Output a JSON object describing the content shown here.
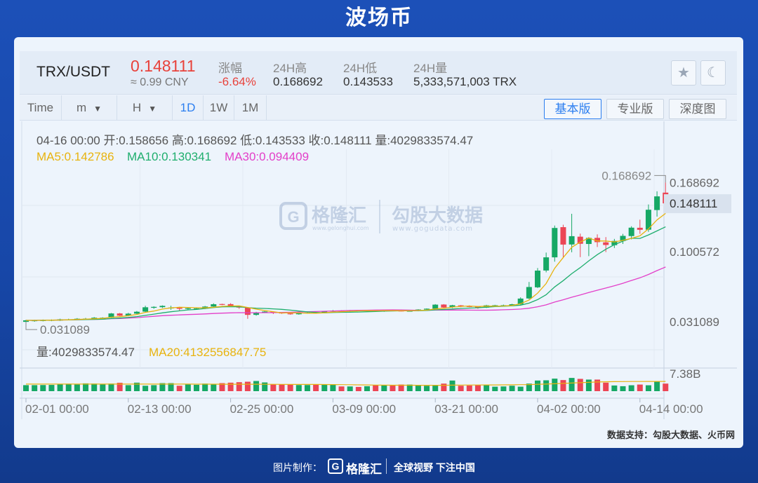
{
  "page": {
    "title": "波场币",
    "source_note": "数据支持：勾股大数据、火币网",
    "footer": {
      "credit": "图片制作：",
      "logo_letter": "G",
      "logo_name": "格隆汇",
      "slogan": "全球视野 下注中国"
    },
    "watermark": {
      "brand1": "格隆汇",
      "brand1_sub": "www.gelonghui.com",
      "brand2": "勾股大数据",
      "brand2_sub": "www.gogudata.com"
    }
  },
  "header": {
    "pair": "TRX/USDT",
    "price": "0.148111",
    "cny": "≈ 0.99 CNY",
    "stats": [
      {
        "label": "涨幅",
        "value": "-6.64%",
        "color": "red"
      },
      {
        "label": "24H高",
        "value": "0.168692",
        "color": "normal"
      },
      {
        "label": "24H低",
        "value": "0.143533",
        "color": "normal"
      },
      {
        "label": "24H量",
        "value": "5,333,571,003 TRX",
        "color": "normal"
      }
    ],
    "icons": [
      "star-icon",
      "moon-icon"
    ]
  },
  "toolbar": {
    "time_label": "Time",
    "minute_select": "m",
    "hour_select": "H",
    "intervals": [
      "1D",
      "1W",
      "1M"
    ],
    "active_interval": "1D",
    "views": [
      "基本版",
      "专业版",
      "深度图"
    ],
    "active_view": "基本版"
  },
  "chart_data": {
    "type": "candlestick",
    "info_line": {
      "date": "04-16 00:00",
      "open_label": "开:",
      "open": "0.158656",
      "high_label": "高:",
      "high": "0.168692",
      "low_label": "低:",
      "low": "0.143533",
      "close_label": "收:",
      "close": "0.148111",
      "vol_label": "量:",
      "vol": "4029833574.47"
    },
    "ma_legend": [
      {
        "label": "MA5:0.142786",
        "color": "#e8b30e"
      },
      {
        "label": "MA10:0.130341",
        "color": "#1fae6e"
      },
      {
        "label": "MA30:0.094409",
        "color": "#e33fc9"
      }
    ],
    "price_axis": {
      "ticks": [
        "0.168692",
        "0.100572",
        "0.031089"
      ],
      "current": "0.148111",
      "range": [
        0.0215,
        0.189
      ]
    },
    "max_label": "0.168692",
    "min_label": "0.031089",
    "volume_legend": [
      {
        "label": "量:4029833574.47",
        "color": "#555555"
      },
      {
        "label": "MA20:4132556847.75",
        "color": "#e8b30e"
      }
    ],
    "volume_axis": {
      "tick": "7.38B",
      "tick_value": 7.38,
      "range": [
        0,
        8.6
      ],
      "unit": "B"
    },
    "x_ticks": [
      {
        "label": "02-01 00:00",
        "index": 0
      },
      {
        "label": "02-13 00:00",
        "index": 12
      },
      {
        "label": "02-25 00:00",
        "index": 24
      },
      {
        "label": "03-09 00:00",
        "index": 36
      },
      {
        "label": "03-21 00:00",
        "index": 48
      },
      {
        "label": "04-02 00:00",
        "index": 60
      },
      {
        "label": "04-14 00:00",
        "index": 72
      }
    ],
    "candles": [
      [
        0.0311,
        0.0326,
        0.0331,
        0.0305
      ],
      [
        0.0318,
        0.0326,
        0.0331,
        0.0312
      ],
      [
        0.032,
        0.0328,
        0.0334,
        0.0316
      ],
      [
        0.0323,
        0.033,
        0.0335,
        0.0318
      ],
      [
        0.0324,
        0.0336,
        0.0342,
        0.032
      ],
      [
        0.0331,
        0.0336,
        0.0342,
        0.0328
      ],
      [
        0.0334,
        0.0342,
        0.0348,
        0.033
      ],
      [
        0.0338,
        0.0343,
        0.035,
        0.0334
      ],
      [
        0.034,
        0.0352,
        0.0358,
        0.0336
      ],
      [
        0.0351,
        0.0352,
        0.0356,
        0.0345
      ],
      [
        0.0352,
        0.0394,
        0.0398,
        0.035
      ],
      [
        0.0394,
        0.0372,
        0.0399,
        0.0368
      ],
      [
        0.0371,
        0.0392,
        0.04,
        0.0366
      ],
      [
        0.0392,
        0.0411,
        0.0418,
        0.0388
      ],
      [
        0.0412,
        0.0455,
        0.047,
        0.0405
      ],
      [
        0.045,
        0.0459,
        0.0465,
        0.044
      ],
      [
        0.0456,
        0.0469,
        0.0474,
        0.0448
      ],
      [
        0.0452,
        0.0452,
        0.047,
        0.043
      ],
      [
        0.045,
        0.044,
        0.046,
        0.042
      ],
      [
        0.0441,
        0.0446,
        0.0456,
        0.043
      ],
      [
        0.044,
        0.0444,
        0.0448,
        0.043
      ],
      [
        0.0443,
        0.0462,
        0.0468,
        0.0438
      ],
      [
        0.0462,
        0.0485,
        0.0494,
        0.0455
      ],
      [
        0.0487,
        0.0483,
        0.049,
        0.0476
      ],
      [
        0.0486,
        0.0464,
        0.0495,
        0.046
      ],
      [
        0.0462,
        0.0452,
        0.0466,
        0.044
      ],
      [
        0.045,
        0.038,
        0.0455,
        0.0341
      ],
      [
        0.038,
        0.0405,
        0.041,
        0.0372
      ],
      [
        0.0404,
        0.0413,
        0.0418,
        0.0398
      ],
      [
        0.0412,
        0.0405,
        0.0415,
        0.0388
      ],
      [
        0.0404,
        0.0394,
        0.0408,
        0.039
      ],
      [
        0.0394,
        0.0386,
        0.0398,
        0.0382
      ],
      [
        0.0386,
        0.0396,
        0.04,
        0.0382
      ],
      [
        0.0396,
        0.0403,
        0.0408,
        0.0392
      ],
      [
        0.0405,
        0.0403,
        0.0408,
        0.0398
      ],
      [
        0.0404,
        0.0414,
        0.0418,
        0.04
      ],
      [
        0.0414,
        0.0422,
        0.0428,
        0.041
      ],
      [
        0.0422,
        0.0414,
        0.0426,
        0.041
      ],
      [
        0.0414,
        0.0424,
        0.0428,
        0.041
      ],
      [
        0.0424,
        0.0422,
        0.0428,
        0.0418
      ],
      [
        0.0422,
        0.0424,
        0.0426,
        0.0418
      ],
      [
        0.0424,
        0.0416,
        0.0428,
        0.0412
      ],
      [
        0.0415,
        0.0423,
        0.0426,
        0.041
      ],
      [
        0.0424,
        0.0422,
        0.0428,
        0.0418
      ],
      [
        0.0422,
        0.0417,
        0.0425,
        0.0414
      ],
      [
        0.0418,
        0.042,
        0.0424,
        0.0414
      ],
      [
        0.042,
        0.0433,
        0.0436,
        0.0416
      ],
      [
        0.0432,
        0.0441,
        0.0444,
        0.0428
      ],
      [
        0.0441,
        0.0481,
        0.0486,
        0.0438
      ],
      [
        0.0482,
        0.0453,
        0.0486,
        0.0448
      ],
      [
        0.0454,
        0.0475,
        0.0479,
        0.0448
      ],
      [
        0.0474,
        0.0467,
        0.0477,
        0.0456
      ],
      [
        0.0466,
        0.0462,
        0.0474,
        0.0456
      ],
      [
        0.0461,
        0.0452,
        0.0466,
        0.044
      ],
      [
        0.0452,
        0.0474,
        0.0479,
        0.0448
      ],
      [
        0.0474,
        0.0475,
        0.0479,
        0.0468
      ],
      [
        0.0474,
        0.0475,
        0.0481,
        0.047
      ],
      [
        0.0474,
        0.0485,
        0.0489,
        0.047
      ],
      [
        0.0484,
        0.0541,
        0.0553,
        0.048
      ],
      [
        0.0542,
        0.0655,
        0.0705,
        0.0535
      ],
      [
        0.0652,
        0.0817,
        0.0842,
        0.0645
      ],
      [
        0.0818,
        0.0948,
        0.0995,
        0.08
      ],
      [
        0.0948,
        0.1238,
        0.1262,
        0.0905
      ],
      [
        0.1246,
        0.1074,
        0.127,
        0.094
      ],
      [
        0.1075,
        0.1157,
        0.1378,
        0.0998
      ],
      [
        0.1152,
        0.1082,
        0.1182,
        0.095
      ],
      [
        0.108,
        0.114,
        0.1148,
        0.096
      ],
      [
        0.114,
        0.1098,
        0.1175,
        0.105
      ],
      [
        0.1096,
        0.107,
        0.1148,
        0.1
      ],
      [
        0.1068,
        0.111,
        0.113,
        0.104
      ],
      [
        0.111,
        0.116,
        0.118,
        0.108
      ],
      [
        0.1158,
        0.1241,
        0.1255,
        0.1125
      ],
      [
        0.124,
        0.122,
        0.132,
        0.118
      ],
      [
        0.1221,
        0.1418,
        0.147,
        0.12
      ],
      [
        0.1415,
        0.155,
        0.16,
        0.135
      ],
      [
        0.1587,
        0.1481,
        0.1687,
        0.1435
      ]
    ],
    "volumes": [
      2.55,
      2.55,
      2.6,
      2.65,
      2.95,
      3.15,
      2.8,
      3.3,
      3.2,
      3.0,
      3.2,
      3.55,
      2.55,
      3.6,
      2.3,
      2.55,
      3.4,
      3.4,
      2.3,
      2.8,
      2.7,
      3.2,
      2.9,
      3.4,
      3.6,
      3.8,
      4.0,
      4.3,
      3.7,
      2.8,
      2.9,
      2.8,
      2.6,
      2.6,
      2.7,
      2.9,
      2.9,
      2.0,
      2.0,
      1.8,
      2.1,
      2.5,
      2.6,
      2.5,
      2.8,
      2.8,
      2.5,
      2.3,
      2.4,
      3.2,
      4.5,
      2.3,
      2.4,
      2.6,
      2.6,
      1.9,
      2.0,
      2.3,
      1.9,
      3.2,
      4.5,
      4.6,
      5.3,
      4.7,
      5.6,
      5.2,
      4.9,
      4.9,
      3.6,
      2.4,
      2.1,
      2.5,
      2.8,
      2.5,
      4.3,
      3.2
    ],
    "vol_ma20": [
      3.0,
      3.0,
      3.0,
      3.0,
      3.0,
      3.0,
      3.0,
      3.0,
      3.0,
      3.0,
      3.0,
      3.0,
      3.0,
      3.0,
      3.0,
      3.0,
      3.0,
      3.0,
      3.0,
      3.0,
      2.98,
      2.97,
      2.96,
      2.95,
      2.94,
      2.93,
      2.93,
      2.93,
      2.92,
      2.9,
      2.88,
      2.86,
      2.85,
      2.85,
      2.84,
      2.82,
      2.8,
      2.76,
      2.72,
      2.68,
      2.63,
      2.58,
      2.55,
      2.53,
      2.52,
      2.51,
      2.5,
      2.48,
      2.48,
      2.5,
      2.55,
      2.58,
      2.6,
      2.62,
      2.64,
      2.64,
      2.66,
      2.7,
      2.75,
      2.8,
      2.9,
      3.0,
      3.15,
      3.3,
      3.45,
      3.6,
      3.75,
      3.88,
      3.97,
      4.02,
      4.05,
      4.08,
      4.1,
      4.11,
      4.12,
      4.13
    ]
  }
}
